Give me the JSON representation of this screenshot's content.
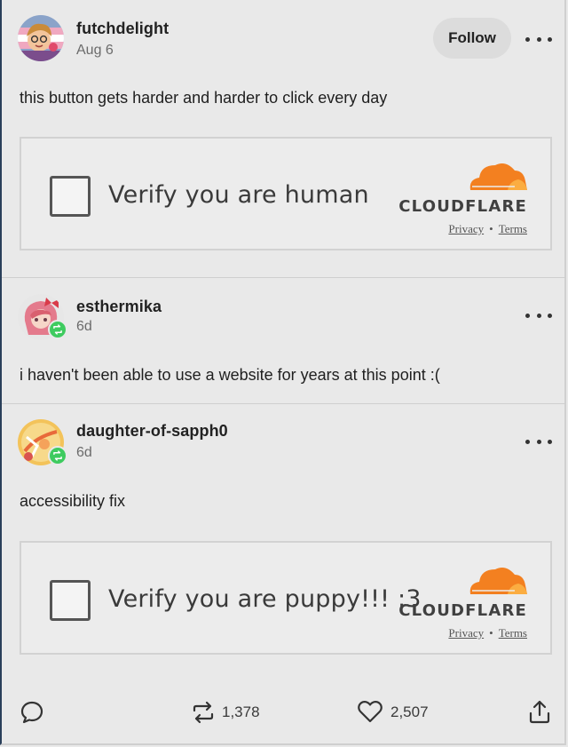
{
  "posts": [
    {
      "username": "futchdelight",
      "date": "Aug 6",
      "follow_label": "Follow",
      "body": "this button gets harder and harder to click every day",
      "captcha": {
        "checkbox_label": "Verify you are human",
        "brand": "CLOUDFLARE",
        "privacy": "Privacy",
        "separator": "•",
        "terms": "Terms"
      }
    },
    {
      "username": "esthermika",
      "date": "6d",
      "body": "i haven't been able to use a website for years at this point :("
    },
    {
      "username": "daughter-of-sapph0",
      "date": "6d",
      "body": "accessibility fix",
      "captcha": {
        "checkbox_label": "Verify you are puppy!!! :3",
        "brand": "CLOUDFLARE",
        "privacy": "Privacy",
        "separator": "•",
        "terms": "Terms"
      }
    }
  ],
  "footer": {
    "reblogs": "1,378",
    "likes": "2,507"
  },
  "icons": {
    "more": "more-dots-icon",
    "reply": "comment-bubble-icon",
    "reblog": "reblog-icon",
    "like": "heart-icon",
    "share": "share-icon"
  },
  "colors": {
    "background": "#e9e9e9",
    "cloudflare_orange": "#f38020",
    "reblog_green": "#3ecb5f"
  }
}
